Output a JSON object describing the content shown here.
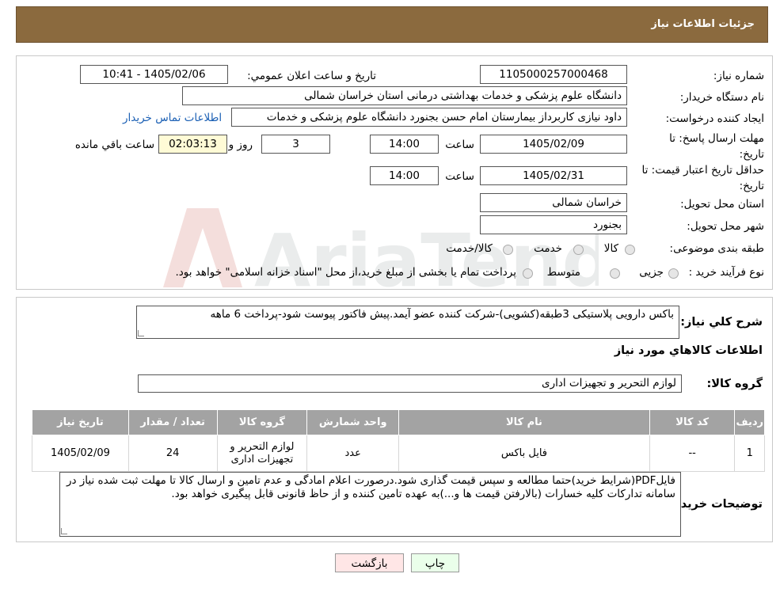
{
  "header": {
    "title": "جزئیات اطلاعات نیاز"
  },
  "form": {
    "need_number_label": "شماره نیاز:",
    "need_number": "1105000257000468",
    "announce_label": "تاریخ و ساعت اعلان عمومي:",
    "announce_value": "1405/02/06 - 10:41",
    "buyer_label": "نام دستگاه خریدار:",
    "buyer_value": "دانشگاه علوم پزشکی و خدمات بهداشتی درمانی استان خراسان شمالی",
    "creator_label": "ایجاد کننده درخواست:",
    "creator_value": "داود نیازی کاربرداز بیمارستان امام حسن بجنورد دانشگاه علوم پزشکی و خدمات",
    "contact_link": "اطلاعات تماس خریدار",
    "deadline_label": "مهلت ارسال پاسخ: تا تاریخ:",
    "deadline_date": "1405/02/09",
    "time_label": "ساعت",
    "deadline_time": "14:00",
    "days_value": "3",
    "days_label": "روز و",
    "remaining_value": "02:03:13",
    "remaining_label": "ساعت باقي مانده",
    "validity_label": "حداقل تاریخ اعتبار قیمت: تا تاریخ:",
    "validity_date": "1405/02/31",
    "validity_time": "14:00",
    "province_label": "استان محل تحویل:",
    "province_value": "خراسان شمالی",
    "city_label": "شهر محل تحویل:",
    "city_value": "بجنورد",
    "category_label": "طبقه بندی موضوعی:",
    "category_options": [
      "کالا",
      "خدمت",
      "کالا/خدمت"
    ],
    "process_label": "نوع فرآیند خرید :",
    "process_options": [
      "جزیی",
      "متوسط"
    ],
    "process_note": "پرداخت تمام یا بخشی از مبلغ خرید،از محل \"اسناد خزانه اسلامی\" خواهد بود."
  },
  "description": {
    "label": "شرح کلي نياز:",
    "value": "باکس دارویی پلاستیکی 3طبقه(کشویی)-شرکت کننده عضو آیمد.پیش فاکتور پیوست  شود-پرداخت 6 ماهه"
  },
  "goods_info_title": "اطلاعات کالاهاي مورد نياز",
  "goods_group": {
    "label": "گروه کالا:",
    "value": "لوازم التحریر و تجهیزات اداری"
  },
  "table": {
    "headers": [
      "ردیف",
      "کد کالا",
      "نام کالا",
      "واحد شمارش",
      "گروه کالا",
      "تعداد / مقدار",
      "تاریخ نیاز"
    ],
    "rows": [
      [
        "1",
        "--",
        "فایل باکس",
        "عدد",
        "لوازم التحریر و تجهیزات اداری",
        "24",
        "1405/02/09"
      ]
    ]
  },
  "buyer_notes": {
    "label": "توضیحات خریدار:",
    "value": "فایلPDF(شرایط خرید)حتما مطالعه و سپس قیمت گذاری شود.درصورت اعلام امادگی و عدم تامین و ارسال کالا تا مهلت ثبت شده نیاز در سامانه تدارکات کلیه خسارات (بالارفتن قیمت ها و...)به عهده تامین کننده و از حاظ قانونی قابل پیگیری خواهد بود."
  },
  "buttons": {
    "print": "چاپ",
    "back": "بازگشت"
  },
  "watermark_text": "AriaTender.neT",
  "colors": {
    "header": "#8b6a3e",
    "table_header": "#a3a3a3",
    "link": "#1a5fb4",
    "print_btn": "#eaffea",
    "back_btn": "#ffe6e6"
  }
}
